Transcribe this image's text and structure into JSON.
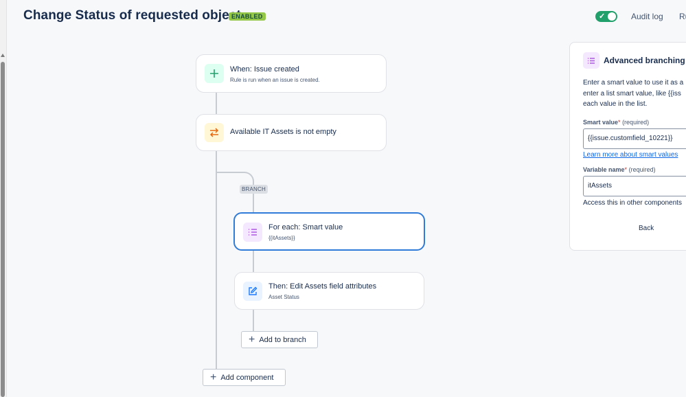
{
  "header": {
    "title": "Change Status of requested object",
    "badge": "ENABLED",
    "toggle_check": "✓",
    "audit_log": "Audit log",
    "rules_link": "Ru"
  },
  "flow": {
    "trigger": {
      "title": "When: Issue created",
      "subtitle": "Rule is run when an issue is created.",
      "icon": "plus-icon"
    },
    "condition": {
      "title": "Available IT Assets is not empty",
      "icon": "swap-arrows-icon"
    },
    "branch_tag": "BRANCH",
    "branch": {
      "title": "For each: Smart value",
      "subtitle": "{{itAssets}}",
      "icon": "list-icon"
    },
    "action": {
      "title": "Then: Edit Assets field attributes",
      "subtitle": "Asset Status",
      "icon": "edit-icon"
    },
    "add_to_branch": "Add to branch",
    "add_component": "Add component"
  },
  "panel": {
    "title": "Advanced branching",
    "desc_lines": [
      "Enter a smart value to use it as a",
      "enter a list smart value, like {{iss",
      "each value in the list."
    ],
    "smart_value_label": "Smart value",
    "required_mark": "*",
    "required_text": "(required)",
    "smart_value": "{{issue.customfield_10221}}",
    "learn_more": "Learn more about smart values",
    "variable_name_label": "Variable name",
    "variable_name": "itAssets",
    "help_text": "Access this in other components",
    "back": "Back"
  },
  "colors": {
    "accent": "#2f7bd9",
    "badge": "#94c748",
    "toggle": "#22a06b",
    "trigger_icon_bg": "#dcfff1",
    "condition_icon_bg": "#fff7d6",
    "branch_icon_bg": "#f3e8fd",
    "action_icon_bg": "#e9f2ff"
  }
}
